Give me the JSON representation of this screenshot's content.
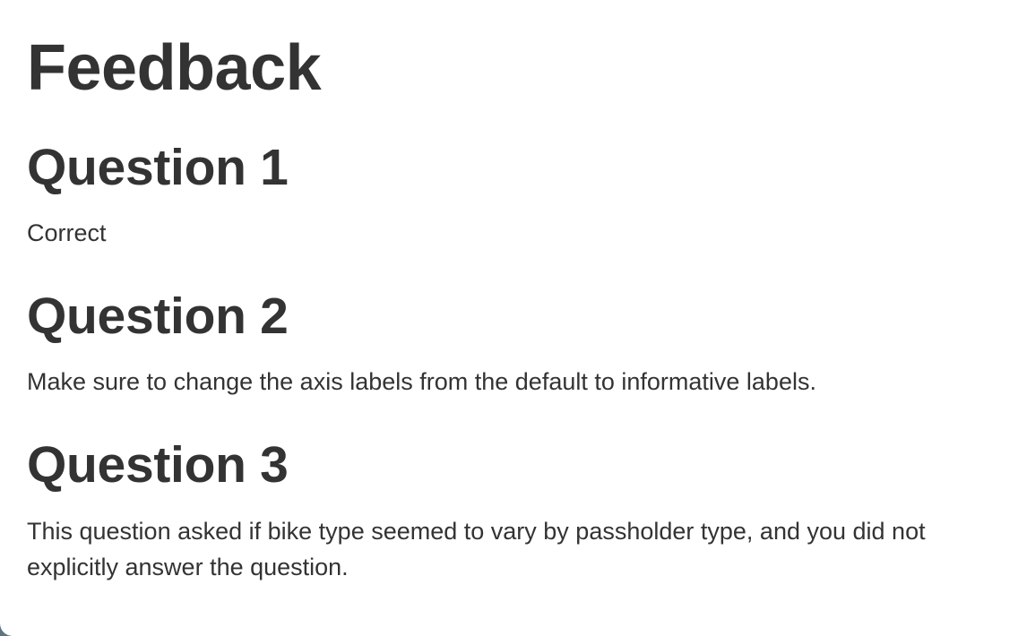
{
  "page": {
    "title": "Feedback"
  },
  "questions": [
    {
      "heading": "Question 1",
      "feedback": "Correct"
    },
    {
      "heading": "Question 2",
      "feedback": "Make sure to change the axis labels from the default to informative labels."
    },
    {
      "heading": "Question 3",
      "feedback": "This question asked if bike type seemed to vary by passholder type, and you did not explicitly answer the question."
    }
  ],
  "colors": {
    "text": "#333333",
    "background": "#ffffff",
    "outer_background": "#5f7480"
  }
}
